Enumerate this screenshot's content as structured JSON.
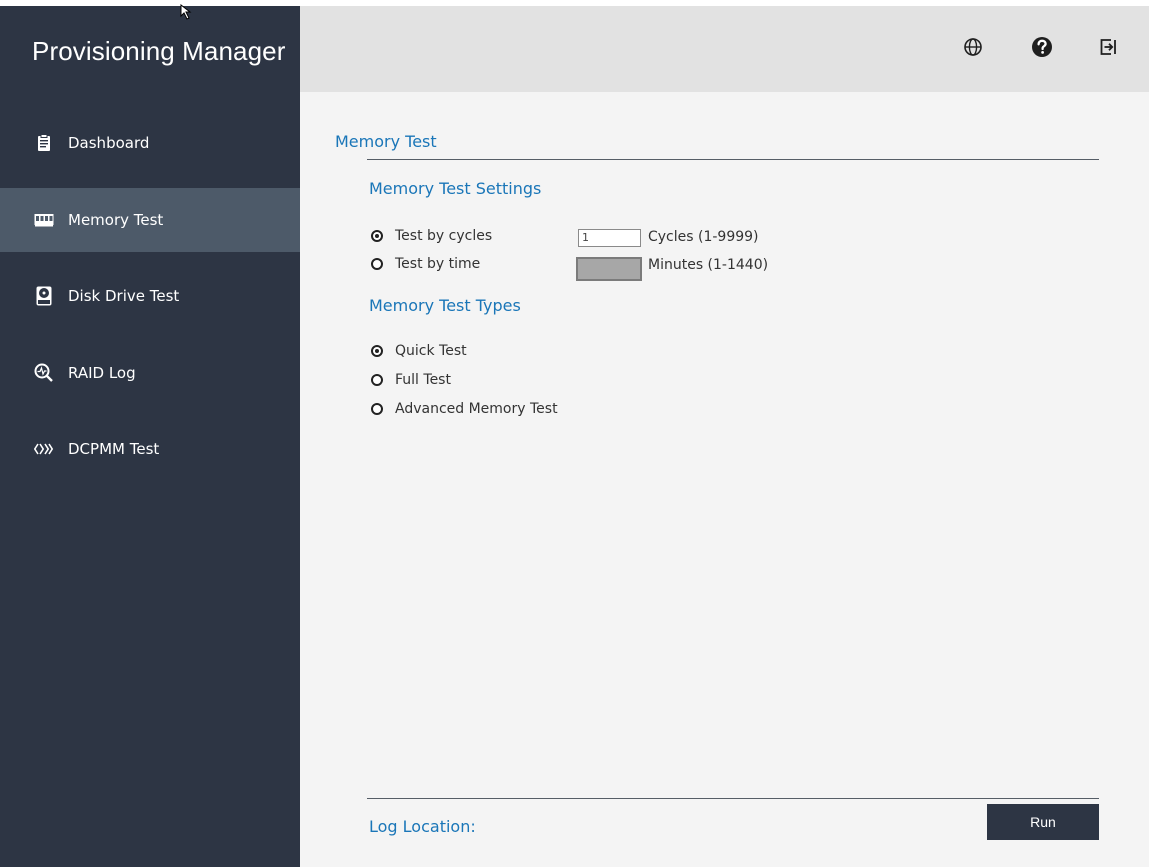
{
  "app": {
    "title": "Provisioning Manager"
  },
  "sidebar": {
    "items": [
      {
        "label": "Dashboard",
        "icon": "clipboard-icon",
        "active": false
      },
      {
        "label": "Memory Test",
        "icon": "ram-icon",
        "active": true
      },
      {
        "label": "Disk Drive Test",
        "icon": "disk-drive-icon",
        "active": false
      },
      {
        "label": "RAID Log",
        "icon": "raid-log-icon",
        "active": false
      },
      {
        "label": "DCPMM Test",
        "icon": "dcpmm-icon",
        "active": false
      }
    ]
  },
  "header": {
    "icons": [
      "globe-icon",
      "help-icon",
      "logout-icon"
    ]
  },
  "main": {
    "title": "Memory Test",
    "settings": {
      "title": "Memory Test Settings",
      "options": [
        {
          "label": "Test by cycles",
          "checked": true
        },
        {
          "label": "Test by time",
          "checked": false
        }
      ],
      "cycles_value": "1",
      "cycles_unit": "Cycles  (1-9999)",
      "minutes_value": "",
      "minutes_unit": "Minutes (1-1440)"
    },
    "types": {
      "title": "Memory Test Types",
      "options": [
        {
          "label": "Quick Test",
          "checked": true
        },
        {
          "label": "Full Test",
          "checked": false
        },
        {
          "label": "Advanced Memory Test",
          "checked": false
        }
      ]
    },
    "log_location_label": "Log Location:",
    "run_label": "Run"
  },
  "colors": {
    "sidebar_bg": "#2d3544",
    "sidebar_active": "#4d5a69",
    "header_bg": "#e2e2e2",
    "accent": "#1a76b8",
    "content_bg": "#f4f4f4"
  }
}
